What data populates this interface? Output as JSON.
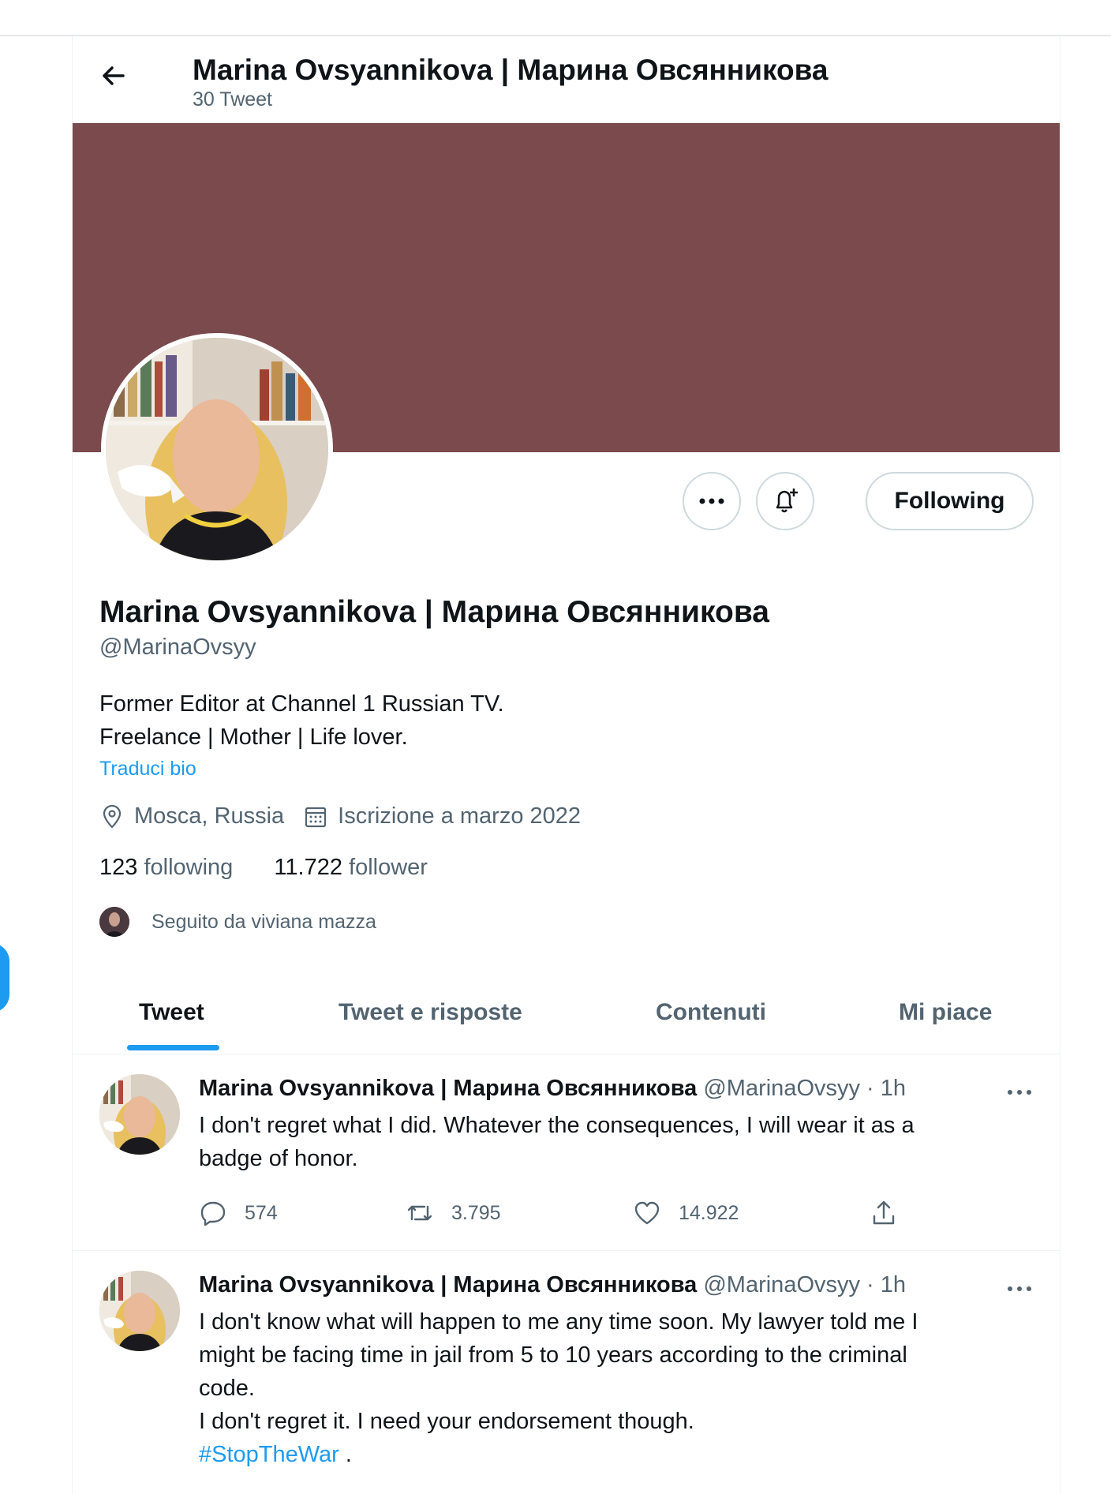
{
  "header": {
    "name": "Marina Ovsyannikova | Марина Овсянникова",
    "tweet_count": "30 Tweet"
  },
  "profile": {
    "name": "Marina Ovsyannikova | Марина Овсянникова",
    "handle": "@MarinaOvsyy",
    "bio_line1": "Former Editor at Channel 1 Russian TV.",
    "bio_line2": "Freelance | Mother | Life lover.",
    "translate_label": "Traduci bio",
    "location": "Mosca, Russia",
    "joined": "Iscrizione a marzo 2022",
    "following_count": "123",
    "following_label": "following",
    "follower_count": "11.722",
    "follower_label": "follower",
    "followed_by": "Seguito da viviana mazza",
    "banner_color": "#7a4a4c"
  },
  "buttons": {
    "following_label": "Following"
  },
  "tabs": [
    {
      "label": "Tweet",
      "active": true
    },
    {
      "label": "Tweet e risposte",
      "active": false
    },
    {
      "label": "Contenuti",
      "active": false
    },
    {
      "label": "Mi piace",
      "active": false
    }
  ],
  "tweets": [
    {
      "name": "Marina Ovsyannikova | Марина Овсянникова",
      "handle_time": "@MarinaOvsyy · 1h",
      "text_line1": "I don't regret what I did. Whatever the consequences, I will wear it as a",
      "text_line2": "badge of honor.",
      "replies": "574",
      "retweets": "3.795",
      "likes": "14.922"
    },
    {
      "name": "Marina Ovsyannikova | Марина Овсянникова",
      "handle_time": "@MarinaOvsyy · 1h",
      "text_line1": "I don't know what will happen to me any time soon. My lawyer told me I",
      "text_line2": "might be facing time in jail from 5 to 10 years according to the criminal",
      "text_line3": "code.",
      "text_line4": "I don't regret it. I need your endorsement though.",
      "hashtag": "#StopTheWar",
      "after_hashtag": " ."
    }
  ],
  "colors": {
    "accent": "#1d9bf0",
    "secondary_text": "#536471"
  }
}
